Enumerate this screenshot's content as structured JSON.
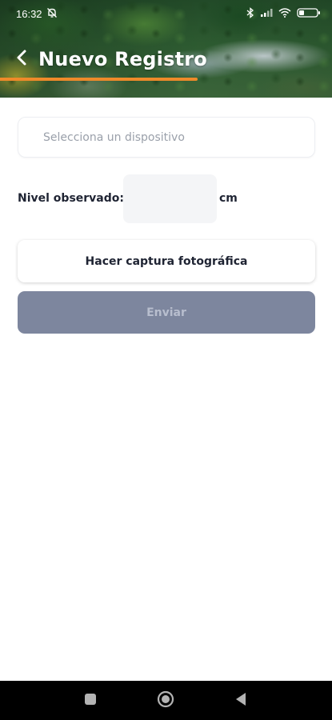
{
  "status_bar": {
    "time": "16:32",
    "icons": [
      "alarm-off-icon",
      "bluetooth-icon",
      "signal-icon",
      "wifi-icon",
      "battery-icon"
    ],
    "battery_level": "24"
  },
  "header": {
    "title": "Nuevo Registro",
    "back_icon": "chevron-left-icon",
    "accent_color": "#ef8a2a"
  },
  "form": {
    "device_placeholder": "Selecciona un dispositivo",
    "level_label": "Nivel observado:",
    "level_value": "",
    "level_unit": "cm",
    "capture_button": "Hacer captura fotográfica",
    "send_button": "Enviar",
    "send_button_color": "#7d869e"
  },
  "nav_bar": {
    "icons": [
      "recents-square-icon",
      "home-circle-icon",
      "back-triangle-icon"
    ]
  }
}
